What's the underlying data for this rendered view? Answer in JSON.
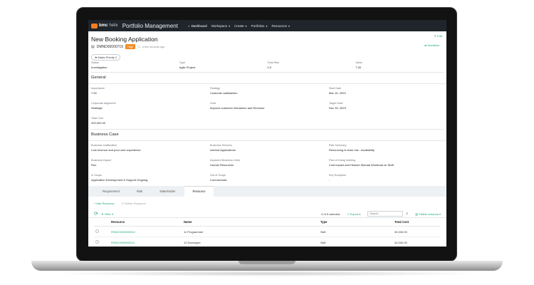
{
  "nav": {
    "brand": "bmc",
    "brand_product": "helix",
    "app_title": "Portfolio Management",
    "items": [
      {
        "label": "Dashboard",
        "icon": "home-icon"
      },
      {
        "label": "Workspace"
      },
      {
        "label": "Create"
      },
      {
        "label": "Portfolios"
      },
      {
        "label": "Resources"
      }
    ]
  },
  "header": {
    "title": "New Booking Application",
    "record_id": "DMND00000719",
    "badge": "High",
    "updated": "a few seconds ago",
    "chip": "Matrix Priority 2",
    "edit_label": "Edit",
    "workflow_label": "Workflow"
  },
  "summary": [
    {
      "label": "Status",
      "value": "Investigation"
    },
    {
      "label": "Type",
      "value": "Agile Project"
    },
    {
      "label": "Total Risk",
      "value": "0.0"
    },
    {
      "label": "Value",
      "value": "7.00"
    }
  ],
  "general": {
    "heading": "General",
    "fields": [
      {
        "label": "Importance",
        "value": "7.00"
      },
      {
        "label": "Strategy",
        "value": "Customer satisfaction"
      },
      {
        "label": "Start Date",
        "value": "Mar 15, 2023"
      },
      {
        "label": "Corporate Alignment",
        "value": "Strategic"
      },
      {
        "label": "Goal",
        "value": "Improve customer interaction and Revenue"
      },
      {
        "label": "Target Date",
        "value": "Nov 30, 2023"
      },
      {
        "label": "Total Cost",
        "value": "200,000.00"
      }
    ]
  },
  "business_case": {
    "heading": "Business Case",
    "fields": [
      {
        "label": "Business Justification",
        "value": "Lost revenue and poor user experience"
      },
      {
        "label": "Business Services",
        "value": "Internal Applications"
      },
      {
        "label": "Risk Summary",
        "value": "Resourcing is team risk - Availability"
      },
      {
        "label": "Business Impact",
        "value": "Run"
      },
      {
        "label": "Impacted Business Units",
        "value": "Human Resources"
      },
      {
        "label": "Pain of Doing Nothing",
        "value": "Cost impact and Heavier Manual Workload on Staff"
      },
      {
        "label": "In Scope",
        "value": "Application Development & Support Ongoing"
      },
      {
        "label": "Out of Scope",
        "value": "Commercials"
      },
      {
        "label": "Key Exception",
        "value": "-"
      }
    ]
  },
  "tabs": [
    "Requirement",
    "Risk",
    "Stakeholder",
    "Resource"
  ],
  "active_tab": "Resource",
  "actions": {
    "add": "+ Add Resource",
    "delete": "✕ Delete Resource"
  },
  "toolbar": {
    "filter": "Filter",
    "selected": "0 of 5 selected",
    "export": "Export",
    "search_placeholder": "Search",
    "visible_columns": "Visible columns"
  },
  "table": {
    "columns": [
      "Resource",
      "Name",
      "Type",
      "Total Cost"
    ],
    "rows": [
      [
        "RSNC0000000010",
        "11 Programmer",
        "Skill",
        "30,000.00"
      ],
      [
        "RSNC0000000011",
        "12 Developer",
        "Skill",
        "42,000.00"
      ]
    ]
  },
  "colors": {
    "accent": "#21a379",
    "nav": "#20252b",
    "badge": "#f08a24"
  }
}
